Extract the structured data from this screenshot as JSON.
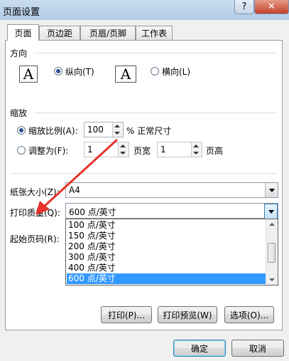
{
  "window": {
    "title": "页面设置",
    "help": "?",
    "close": "✕"
  },
  "tabs": [
    "页面",
    "页边距",
    "页眉/页脚",
    "工作表"
  ],
  "orientation": {
    "label": "方向",
    "icon_glyph": "A",
    "portrait": "纵向(T)",
    "landscape": "横向(L)",
    "selected": "portrait"
  },
  "scaling": {
    "label": "缩放",
    "adjust_to": "缩放比例(A):",
    "adjust_value": "100",
    "adjust_suffix": "% 正常尺寸",
    "fit_to": "调整为(F):",
    "wide_value": "1",
    "wide_suffix": "页宽",
    "tall_value": "1",
    "tall_suffix": "页高"
  },
  "paper_size": {
    "label": "纸张大小(Z):",
    "value": "A4"
  },
  "print_quality": {
    "label": "打印质量(Q):",
    "value": "600 点/英寸",
    "options": [
      "100 点/英寸",
      "150 点/英寸",
      "200 点/英寸",
      "300 点/英寸",
      "400 点/英寸",
      "600 点/英寸"
    ],
    "selected_index": 5
  },
  "first_page": {
    "label": "起始页码(R):"
  },
  "buttons": {
    "print": "打印(P)...",
    "preview": "打印预览(W)",
    "options": "选项(O)...",
    "ok": "确定",
    "cancel": "取消"
  },
  "colors": {
    "accent": "#3399ff",
    "annotation_arrow": "#e8322b"
  }
}
